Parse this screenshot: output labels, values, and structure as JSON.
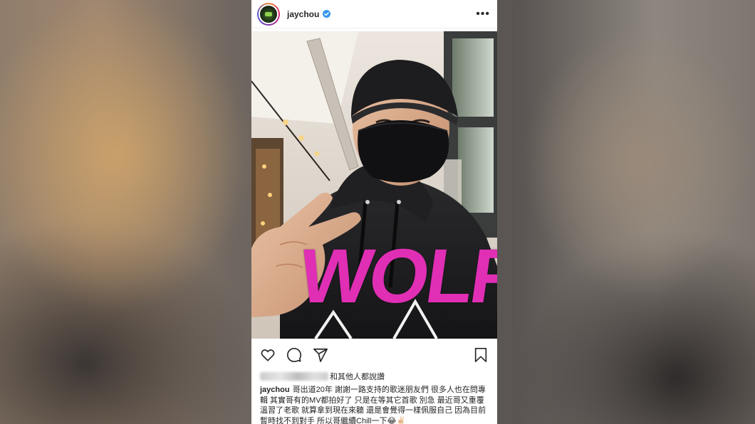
{
  "post": {
    "username": "jaychou",
    "more_label": "•••",
    "likes_text": "和其他人都說讚",
    "caption_username": "jaychou",
    "caption_text": "哥出道20年 謝謝一路支持的歌迷朋友們 很多人也在問專輯 其實哥有的MV都拍好了 只是在等其它首歌 別急 最近哥又重覆溫習了老歌 就算拿到現在來聽 還是會覺得一樣佩服自己 因為目前暫時找不到對手 所以哥繼續Chill一下😂✌🏻",
    "hoodie_text": "WOLF"
  },
  "colors": {
    "verified": "#3897f0",
    "hoodie_print": "#e02fb5"
  },
  "icons": [
    "heart-icon",
    "comment-icon",
    "share-icon",
    "bookmark-icon",
    "verified-icon",
    "more-icon"
  ]
}
